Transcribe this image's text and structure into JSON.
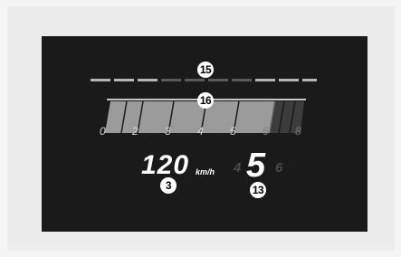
{
  "callouts": {
    "shift_indicator": "15",
    "rpm_bar": "16",
    "speedometer": "3",
    "gear_indicator": "13"
  },
  "tachometer": {
    "scale_labels": [
      "0",
      "2",
      "3",
      "4",
      "5",
      "6",
      "8"
    ]
  },
  "speed": {
    "value": "120",
    "unit": "km/h"
  },
  "gear": {
    "prev": "4",
    "current": "5",
    "next": "6"
  }
}
